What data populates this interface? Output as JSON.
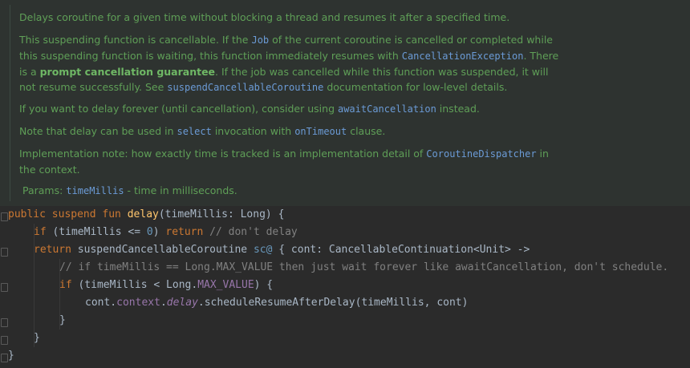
{
  "doc": {
    "p1": "Delays coroutine for a given time without blocking a thread and resumes it after a specified time.",
    "p2": {
      "t1": "This suspending function is cancellable. If the ",
      "job": "Job",
      "t2": " of the current coroutine is cancelled or completed while this suspending function is waiting, this function immediately resumes with ",
      "cancel_ex": "CancellationException",
      "t3": ". There is a ",
      "bold": "prompt cancellation guarantee",
      "t4": ". If the job was cancelled while this function was suspended, it will not resume successfully. See ",
      "scc": "suspendCancellableCoroutine",
      "t5": " documentation for low-level details."
    },
    "p3": {
      "t1": "If you want to delay forever (until cancellation), consider using ",
      "await": "awaitCancellation",
      "t2": " instead."
    },
    "p4": {
      "t1": "Note that delay can be used in ",
      "select": "select",
      "t2": " invocation with ",
      "ontimeout": "onTimeout",
      "t3": " clause."
    },
    "p5": {
      "t1": "Implementation note: how exactly time is tracked is an implementation detail of ",
      "dispatcher": "CoroutineDispatcher",
      "t2": " in the context."
    },
    "params": {
      "label": "Params: ",
      "name": "timeMillis",
      "desc": " - time in milliseconds."
    }
  },
  "code": {
    "l1": {
      "kw": "public suspend fun ",
      "fn": "delay",
      "rest": "(timeMillis: Long) {"
    },
    "l2": {
      "kw1": "if",
      "a": " (timeMillis <= ",
      "num": "0",
      "b": ") ",
      "kw2": "return",
      "cmt": " // don't delay"
    },
    "l3": {
      "kw": "return",
      "a": " suspendCancellableCoroutine ",
      "label": "sc@",
      "b": " { cont: CancellableContinuation<Unit> ->"
    },
    "l4": {
      "cmt": "// if timeMillis == Long.MAX_VALUE then just wait forever like awaitCancellation, don't schedule."
    },
    "l5": {
      "kw": "if",
      "a": " (timeMillis < Long.",
      "prop": "MAX_VALUE",
      "b": ") {"
    },
    "l6": {
      "a": "cont.",
      "prop": "context",
      "dot": ".",
      "it": "delay",
      "b": ".scheduleResumeAfterDelay(timeMillis, cont)"
    },
    "l7": "}",
    "l8": "}",
    "l9": "}"
  }
}
